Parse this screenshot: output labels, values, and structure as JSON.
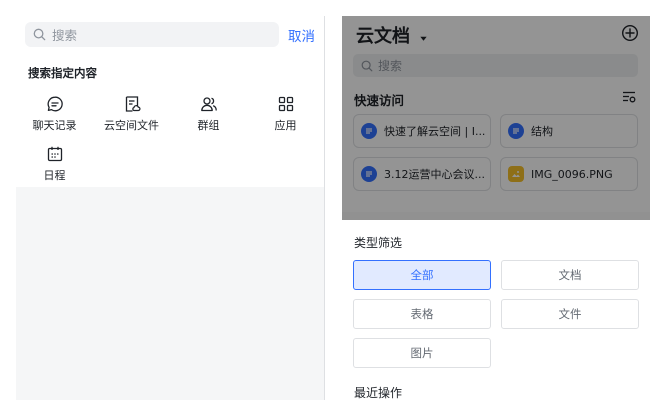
{
  "left": {
    "search_placeholder": "搜索",
    "cancel_label": "取消",
    "section_label": "搜索指定内容",
    "categories": [
      {
        "label": "聊天记录",
        "icon": "chat-icon"
      },
      {
        "label": "云空间文件",
        "icon": "cloud-file-icon"
      },
      {
        "label": "群组",
        "icon": "group-icon"
      },
      {
        "label": "应用",
        "icon": "apps-grid-icon"
      },
      {
        "label": "日程",
        "icon": "calendar-icon"
      }
    ]
  },
  "right": {
    "title": "云文档",
    "search_placeholder": "搜索",
    "quick_access_label": "快速访问",
    "quick_items": [
      {
        "label": "快速了解云空间 | I...",
        "icon": "doc-icon"
      },
      {
        "label": "结构",
        "icon": "doc-icon"
      },
      {
        "label": "3.12运营中心会议...",
        "icon": "doc-icon"
      },
      {
        "label": "IMG_0096.PNG",
        "icon": "image-icon"
      }
    ],
    "filter_sheet": {
      "title": "类型筛选",
      "options": [
        "全部",
        "文档",
        "表格",
        "文件",
        "图片"
      ],
      "selected": "全部",
      "recent_label": "最近操作"
    }
  },
  "colors": {
    "accent": "#3370ff",
    "overlay": "rgba(0,0,0,0.42)",
    "muted_text": "#8f959e"
  }
}
